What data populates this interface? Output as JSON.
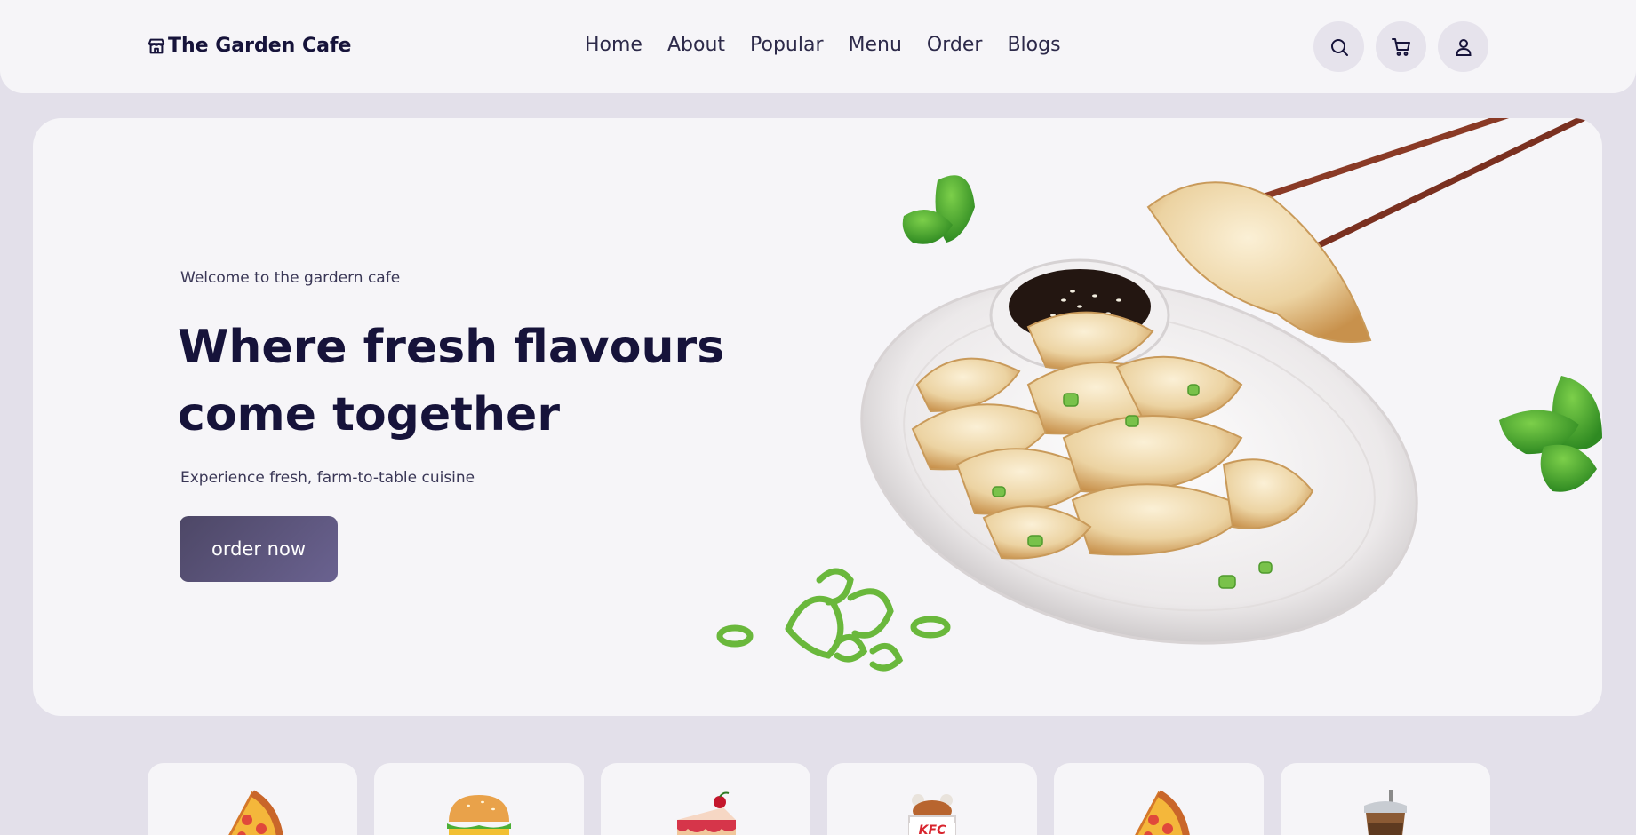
{
  "brand": {
    "name": "The Garden Cafe",
    "icon": "store-icon"
  },
  "nav": {
    "items": [
      "Home",
      "About",
      "Popular",
      "Menu",
      "Order",
      "Blogs"
    ]
  },
  "header_actions": {
    "search_icon": "search-icon",
    "cart_icon": "cart-icon",
    "user_icon": "user-icon"
  },
  "hero": {
    "welcome": "Welcome to the gardern cafe",
    "headline": "Where fresh flavours come together",
    "subtext": "Experience fresh, farm-to-table cuisine",
    "cta_label": "order now"
  },
  "categories": [
    {
      "icon": "pizza-icon"
    },
    {
      "icon": "burger-icon"
    },
    {
      "icon": "cake-icon"
    },
    {
      "icon": "kfc-chicken-icon",
      "label": "KFC"
    },
    {
      "icon": "pizza-icon"
    },
    {
      "icon": "drink-cup-icon"
    }
  ],
  "colors": {
    "page_bg": "#e3e0ea",
    "surface": "#f6f5f8",
    "text_dark": "#16133a",
    "button": "#574f76"
  }
}
